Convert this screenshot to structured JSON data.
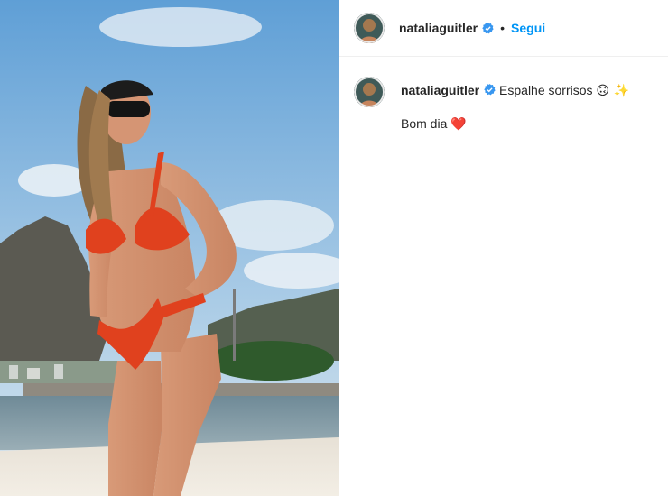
{
  "post": {
    "username": "nataliaguitler",
    "follow_label": "Segui",
    "separator": "•",
    "caption_line1": "Espalhe sorrisos",
    "caption_line1_emoji": "🙃 ✨",
    "caption_line2": "Bom dia",
    "caption_line2_emoji": "❤️"
  },
  "icons": {
    "verified": "verified-badge-icon",
    "avatar": "profile-avatar"
  },
  "colors": {
    "accent": "#0095f6",
    "verified": "#3897f0",
    "text": "#262626",
    "border": "#efefef"
  }
}
